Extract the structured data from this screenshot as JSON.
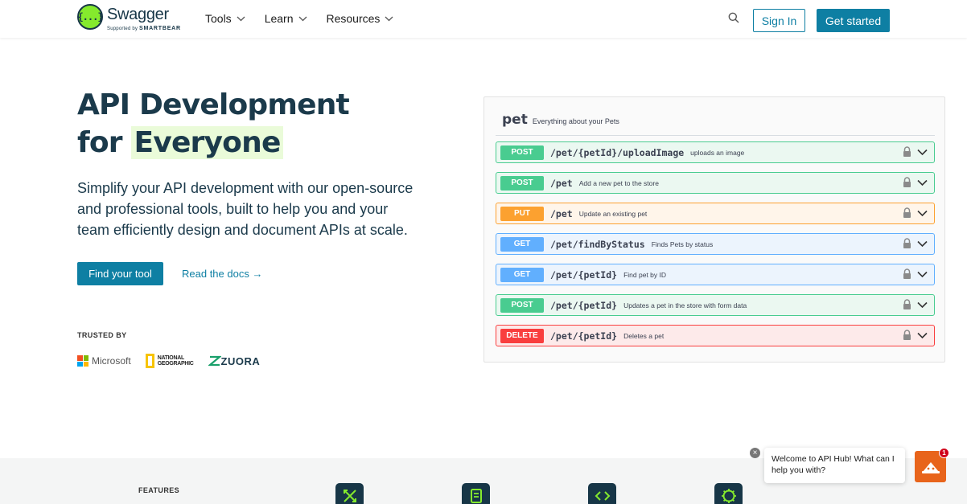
{
  "header": {
    "logo_mark": "{...}",
    "logo_name": "Swagger",
    "logo_sub_prefix": "Supported by",
    "logo_sub_brand": "SMARTBEAR",
    "nav": [
      {
        "label": "Tools"
      },
      {
        "label": "Learn"
      },
      {
        "label": "Resources"
      }
    ],
    "sign_in": "Sign In",
    "get_started": "Get started"
  },
  "hero": {
    "title_line1": "API Development",
    "title_for": "for",
    "title_highlight": "Everyone",
    "description": "Simplify your API development with our open-source and professional tools, built to help you and your team efficiently design and document APIs at scale.",
    "primary_button": "Find your tool",
    "docs_link": "Read the docs →",
    "trusted_by": "TRUSTED BY",
    "logos": {
      "microsoft": "Microsoft",
      "natgeo_line1": "NATIONAL",
      "natgeo_line2": "GEOGRAPHIC",
      "zuora": "ZUORA"
    }
  },
  "swagger_panel": {
    "tag": "pet",
    "tag_description": "Everything about your Pets",
    "operations": [
      {
        "method": "POST",
        "path": "/pet/{petId}/uploadImage",
        "summary": "uploads an image"
      },
      {
        "method": "POST",
        "path": "/pet",
        "summary": "Add a new pet to the store"
      },
      {
        "method": "PUT",
        "path": "/pet",
        "summary": "Update an existing pet"
      },
      {
        "method": "GET",
        "path": "/pet/findByStatus",
        "summary": "Finds Pets by status"
      },
      {
        "method": "GET",
        "path": "/pet/{petId}",
        "summary": "Find pet by ID"
      },
      {
        "method": "POST",
        "path": "/pet/{petId}",
        "summary": "Updates a pet in the store with form data"
      },
      {
        "method": "DELETE",
        "path": "/pet/{petId}",
        "summary": "Deletes a pet"
      }
    ],
    "method_colors": {
      "POST": {
        "bg": "#49cc90",
        "tint": "#ebf8f1",
        "border": "#49cc90"
      },
      "PUT": {
        "bg": "#fca130",
        "tint": "#fff5ea",
        "border": "#fca130"
      },
      "GET": {
        "bg": "#61affe",
        "tint": "#ecf4fd",
        "border": "#61affe"
      },
      "DELETE": {
        "bg": "#f93e3e",
        "tint": "#fdeaea",
        "border": "#f93e3e"
      }
    }
  },
  "features": {
    "label": "FEATURES",
    "icons": [
      "design-icon",
      "document-icon",
      "code-icon",
      "settings-code-icon"
    ]
  },
  "chat": {
    "message": "Welcome to API Hub! What can I help you with?",
    "badge_count": "1",
    "close_glyph": "×"
  },
  "colors": {
    "brand": "#0e7fa3",
    "logo_green": "#85ea2d",
    "navy": "#173647",
    "chat_orange": "#e8641b"
  }
}
